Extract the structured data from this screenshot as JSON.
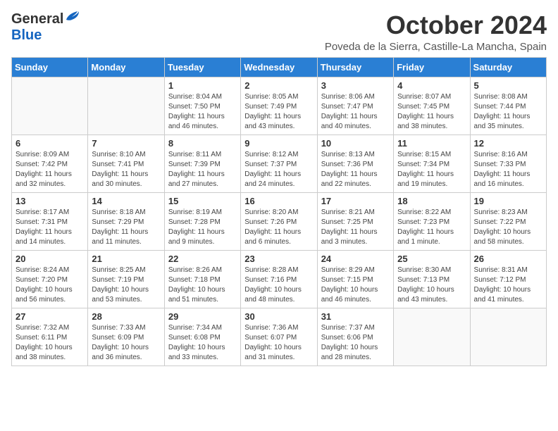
{
  "header": {
    "logo_general": "General",
    "logo_blue": "Blue",
    "month_title": "October 2024",
    "location": "Poveda de la Sierra, Castille-La Mancha, Spain"
  },
  "days_of_week": [
    "Sunday",
    "Monday",
    "Tuesday",
    "Wednesday",
    "Thursday",
    "Friday",
    "Saturday"
  ],
  "weeks": [
    [
      {
        "day": "",
        "info": ""
      },
      {
        "day": "",
        "info": ""
      },
      {
        "day": "1",
        "info": "Sunrise: 8:04 AM\nSunset: 7:50 PM\nDaylight: 11 hours and 46 minutes."
      },
      {
        "day": "2",
        "info": "Sunrise: 8:05 AM\nSunset: 7:49 PM\nDaylight: 11 hours and 43 minutes."
      },
      {
        "day": "3",
        "info": "Sunrise: 8:06 AM\nSunset: 7:47 PM\nDaylight: 11 hours and 40 minutes."
      },
      {
        "day": "4",
        "info": "Sunrise: 8:07 AM\nSunset: 7:45 PM\nDaylight: 11 hours and 38 minutes."
      },
      {
        "day": "5",
        "info": "Sunrise: 8:08 AM\nSunset: 7:44 PM\nDaylight: 11 hours and 35 minutes."
      }
    ],
    [
      {
        "day": "6",
        "info": "Sunrise: 8:09 AM\nSunset: 7:42 PM\nDaylight: 11 hours and 32 minutes."
      },
      {
        "day": "7",
        "info": "Sunrise: 8:10 AM\nSunset: 7:41 PM\nDaylight: 11 hours and 30 minutes."
      },
      {
        "day": "8",
        "info": "Sunrise: 8:11 AM\nSunset: 7:39 PM\nDaylight: 11 hours and 27 minutes."
      },
      {
        "day": "9",
        "info": "Sunrise: 8:12 AM\nSunset: 7:37 PM\nDaylight: 11 hours and 24 minutes."
      },
      {
        "day": "10",
        "info": "Sunrise: 8:13 AM\nSunset: 7:36 PM\nDaylight: 11 hours and 22 minutes."
      },
      {
        "day": "11",
        "info": "Sunrise: 8:15 AM\nSunset: 7:34 PM\nDaylight: 11 hours and 19 minutes."
      },
      {
        "day": "12",
        "info": "Sunrise: 8:16 AM\nSunset: 7:33 PM\nDaylight: 11 hours and 16 minutes."
      }
    ],
    [
      {
        "day": "13",
        "info": "Sunrise: 8:17 AM\nSunset: 7:31 PM\nDaylight: 11 hours and 14 minutes."
      },
      {
        "day": "14",
        "info": "Sunrise: 8:18 AM\nSunset: 7:29 PM\nDaylight: 11 hours and 11 minutes."
      },
      {
        "day": "15",
        "info": "Sunrise: 8:19 AM\nSunset: 7:28 PM\nDaylight: 11 hours and 9 minutes."
      },
      {
        "day": "16",
        "info": "Sunrise: 8:20 AM\nSunset: 7:26 PM\nDaylight: 11 hours and 6 minutes."
      },
      {
        "day": "17",
        "info": "Sunrise: 8:21 AM\nSunset: 7:25 PM\nDaylight: 11 hours and 3 minutes."
      },
      {
        "day": "18",
        "info": "Sunrise: 8:22 AM\nSunset: 7:23 PM\nDaylight: 11 hours and 1 minute."
      },
      {
        "day": "19",
        "info": "Sunrise: 8:23 AM\nSunset: 7:22 PM\nDaylight: 10 hours and 58 minutes."
      }
    ],
    [
      {
        "day": "20",
        "info": "Sunrise: 8:24 AM\nSunset: 7:20 PM\nDaylight: 10 hours and 56 minutes."
      },
      {
        "day": "21",
        "info": "Sunrise: 8:25 AM\nSunset: 7:19 PM\nDaylight: 10 hours and 53 minutes."
      },
      {
        "day": "22",
        "info": "Sunrise: 8:26 AM\nSunset: 7:18 PM\nDaylight: 10 hours and 51 minutes."
      },
      {
        "day": "23",
        "info": "Sunrise: 8:28 AM\nSunset: 7:16 PM\nDaylight: 10 hours and 48 minutes."
      },
      {
        "day": "24",
        "info": "Sunrise: 8:29 AM\nSunset: 7:15 PM\nDaylight: 10 hours and 46 minutes."
      },
      {
        "day": "25",
        "info": "Sunrise: 8:30 AM\nSunset: 7:13 PM\nDaylight: 10 hours and 43 minutes."
      },
      {
        "day": "26",
        "info": "Sunrise: 8:31 AM\nSunset: 7:12 PM\nDaylight: 10 hours and 41 minutes."
      }
    ],
    [
      {
        "day": "27",
        "info": "Sunrise: 7:32 AM\nSunset: 6:11 PM\nDaylight: 10 hours and 38 minutes."
      },
      {
        "day": "28",
        "info": "Sunrise: 7:33 AM\nSunset: 6:09 PM\nDaylight: 10 hours and 36 minutes."
      },
      {
        "day": "29",
        "info": "Sunrise: 7:34 AM\nSunset: 6:08 PM\nDaylight: 10 hours and 33 minutes."
      },
      {
        "day": "30",
        "info": "Sunrise: 7:36 AM\nSunset: 6:07 PM\nDaylight: 10 hours and 31 minutes."
      },
      {
        "day": "31",
        "info": "Sunrise: 7:37 AM\nSunset: 6:06 PM\nDaylight: 10 hours and 28 minutes."
      },
      {
        "day": "",
        "info": ""
      },
      {
        "day": "",
        "info": ""
      }
    ]
  ]
}
